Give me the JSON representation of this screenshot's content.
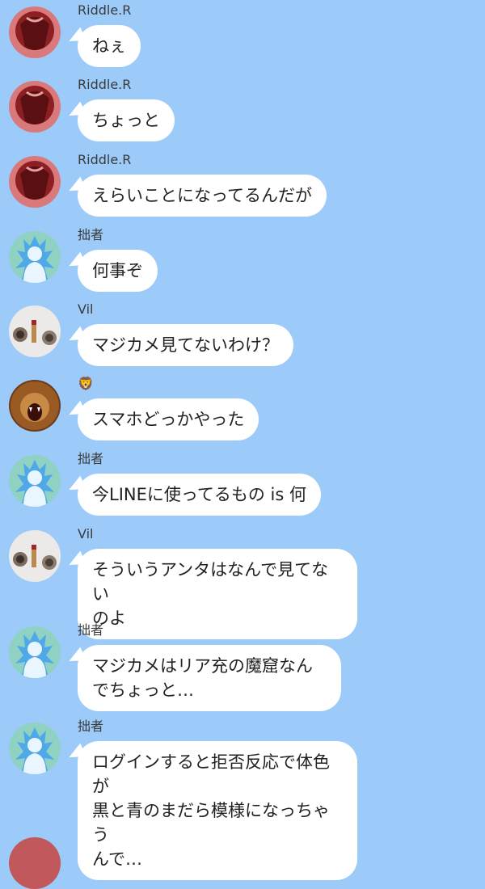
{
  "colors": {
    "background": "#9ccbf9",
    "bubble": "#ffffff",
    "name_text": "#3b3b3b",
    "message_text": "#222222"
  },
  "messages": [
    {
      "sender": "Riddle.R",
      "avatar": "riddle-avatar-icon",
      "text": "ねぇ"
    },
    {
      "sender": "Riddle.R",
      "avatar": "riddle-avatar-icon",
      "text": "ちょっと"
    },
    {
      "sender": "Riddle.R",
      "avatar": "riddle-avatar-icon",
      "text": "えらいことになってるんだが"
    },
    {
      "sender": "拙者",
      "avatar": "blue-silhouette-avatar-icon",
      "text": "何事ぞ"
    },
    {
      "sender": "Vil",
      "avatar": "lipstick-avatar-icon",
      "text": "マジカメ見てないわけ？"
    },
    {
      "sender": "🦁",
      "avatar": "lion-avatar-icon",
      "text": "スマホどっかやった"
    },
    {
      "sender": "拙者",
      "avatar": "blue-silhouette-avatar-icon",
      "text": "今LINEに使ってるもの is 何"
    },
    {
      "sender": "Vil",
      "avatar": "lipstick-avatar-icon",
      "text": "そういうアンタはなんで見てない\nのよ"
    },
    {
      "sender": "拙者",
      "avatar": "blue-silhouette-avatar-icon",
      "text": "マジカメはリア充の魔窟なん\nでちょっと…"
    },
    {
      "sender": "拙者",
      "avatar": "blue-silhouette-avatar-icon",
      "text": "ログインすると拒否反応で体色が\n黒と青のまだら模様になっちゃう\nんで…"
    }
  ]
}
